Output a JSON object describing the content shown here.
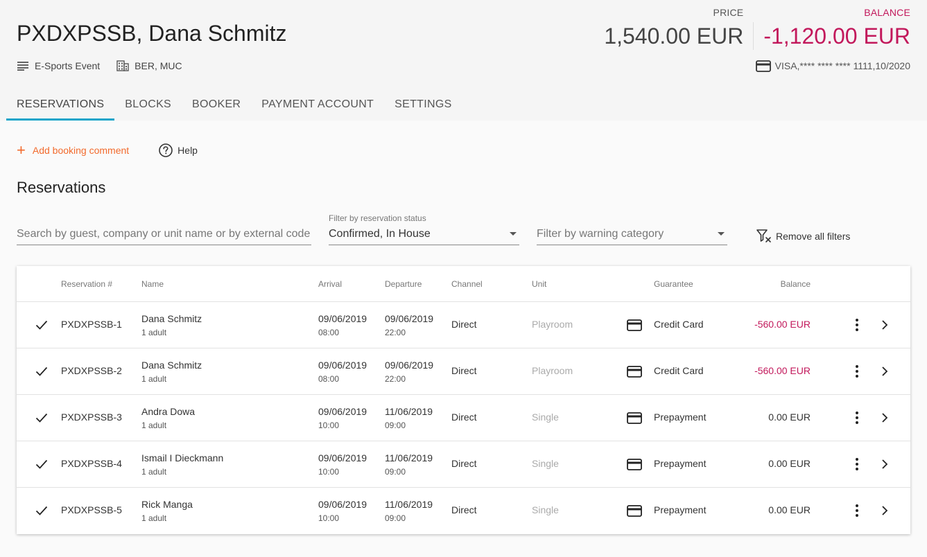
{
  "header": {
    "title": "PXDXPSSB, Dana Schmitz",
    "event": "E-Sports Event",
    "locations": "BER, MUC",
    "price_label": "PRICE",
    "price_value": "1,540.00 EUR",
    "balance_label": "BALANCE",
    "balance_value": "-1,120.00 EUR",
    "card_info": "VISA,**** **** **** 1111,10/2020"
  },
  "tabs": [
    {
      "label": "RESERVATIONS",
      "active": true
    },
    {
      "label": "BLOCKS"
    },
    {
      "label": "BOOKER"
    },
    {
      "label": "PAYMENT ACCOUNT"
    },
    {
      "label": "SETTINGS"
    }
  ],
  "actions": {
    "add_comment": "Add booking comment",
    "help": "Help"
  },
  "section_title": "Reservations",
  "filters": {
    "search_placeholder": "Search by guest, company or unit name or by external code",
    "status_label": "Filter by reservation status",
    "status_value": "Confirmed, In House",
    "warning_placeholder": "Filter by warning category",
    "remove_all": "Remove all filters"
  },
  "table": {
    "columns": [
      "Reservation #",
      "Name",
      "Arrival",
      "Departure",
      "Channel",
      "Unit",
      "Guarantee",
      "Balance"
    ],
    "rows": [
      {
        "id": "PXDXPSSB-1",
        "name": "Dana Schmitz",
        "guests": "1 adult",
        "arrival_date": "09/06/2019",
        "arrival_time": "08:00",
        "departure_date": "09/06/2019",
        "departure_time": "22:00",
        "channel": "Direct",
        "unit": "Playroom",
        "guarantee": "Credit Card",
        "balance": "-560.00 EUR",
        "negative": true
      },
      {
        "id": "PXDXPSSB-2",
        "name": "Dana Schmitz",
        "guests": "1 adult",
        "arrival_date": "09/06/2019",
        "arrival_time": "08:00",
        "departure_date": "09/06/2019",
        "departure_time": "22:00",
        "channel": "Direct",
        "unit": "Playroom",
        "guarantee": "Credit Card",
        "balance": "-560.00 EUR",
        "negative": true
      },
      {
        "id": "PXDXPSSB-3",
        "name": "Andra Dowa",
        "guests": "1 adult",
        "arrival_date": "09/06/2019",
        "arrival_time": "10:00",
        "departure_date": "11/06/2019",
        "departure_time": "09:00",
        "channel": "Direct",
        "unit": "Single",
        "guarantee": "Prepayment",
        "balance": "0.00 EUR",
        "negative": false
      },
      {
        "id": "PXDXPSSB-4",
        "name": "Ismail I Dieckmann",
        "guests": "1 adult",
        "arrival_date": "09/06/2019",
        "arrival_time": "10:00",
        "departure_date": "11/06/2019",
        "departure_time": "09:00",
        "channel": "Direct",
        "unit": "Single",
        "guarantee": "Prepayment",
        "balance": "0.00 EUR",
        "negative": false
      },
      {
        "id": "PXDXPSSB-5",
        "name": "Rick Manga",
        "guests": "1 adult",
        "arrival_date": "09/06/2019",
        "arrival_time": "10:00",
        "departure_date": "11/06/2019",
        "departure_time": "09:00",
        "channel": "Direct",
        "unit": "Single",
        "guarantee": "Prepayment",
        "balance": "0.00 EUR",
        "negative": false
      }
    ]
  },
  "colors": {
    "accent_tab": "#15a4c9",
    "add_action": "#f26a2c",
    "negative": "#c2185b"
  }
}
